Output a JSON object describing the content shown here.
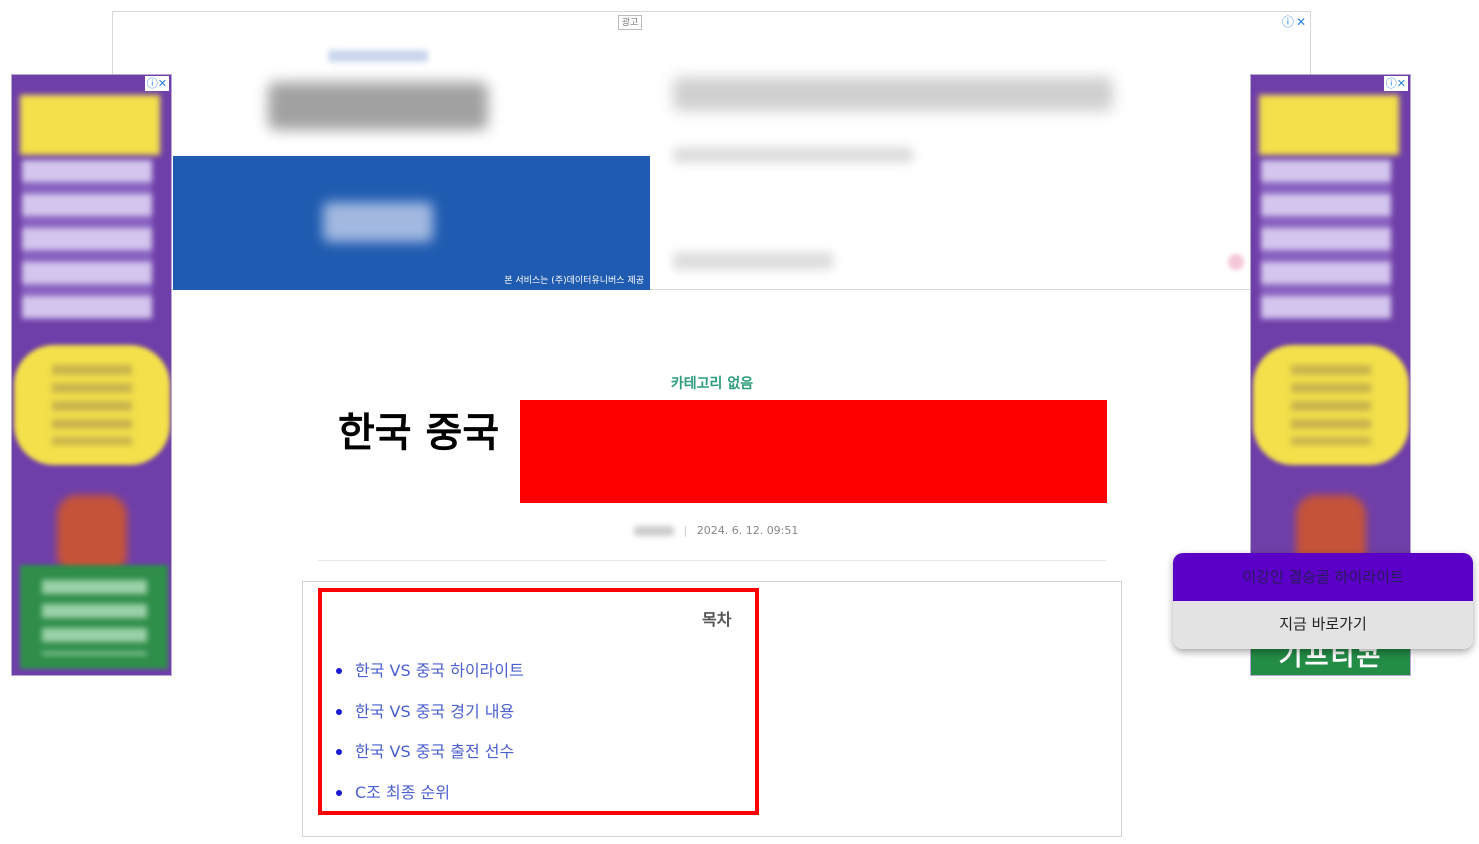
{
  "top_ad": {
    "ad_label": "광고",
    "adchoice": "ⓘ",
    "close": "✕",
    "provider_text": "본 서비스는 (주)데이터유니버스 제공",
    "colors": {
      "confirm_bg": "#1f5bb0"
    }
  },
  "side_ads": {
    "adchoice": "ⓘ✕",
    "brand_text": "기프티콘",
    "colors": {
      "bg": "#6f3fa9",
      "accent": "#f3e04a"
    }
  },
  "article": {
    "category": "카테고리 없음",
    "title": "한국 중국",
    "date": "2024. 6. 12. 09:51",
    "meta_separator": "|"
  },
  "toc": {
    "heading": "목차",
    "items": [
      "한국 VS 중국 하이라이트",
      "한국 VS 중국 경기 내용",
      "한국 VS 중국 출전 선수",
      "C조 최종 순위"
    ]
  },
  "popup": {
    "top_text": "이강인 결승골 하이라이트",
    "button_label": "지금 바로가기",
    "colors": {
      "top_bg": "#5a00c7",
      "bottom_bg": "#e3e3e3"
    }
  },
  "colors": {
    "category": "#2d9c7e",
    "redaction": "#ff0000",
    "toc_highlight": "#ff0000",
    "toc_link": "#4b5fd0"
  }
}
